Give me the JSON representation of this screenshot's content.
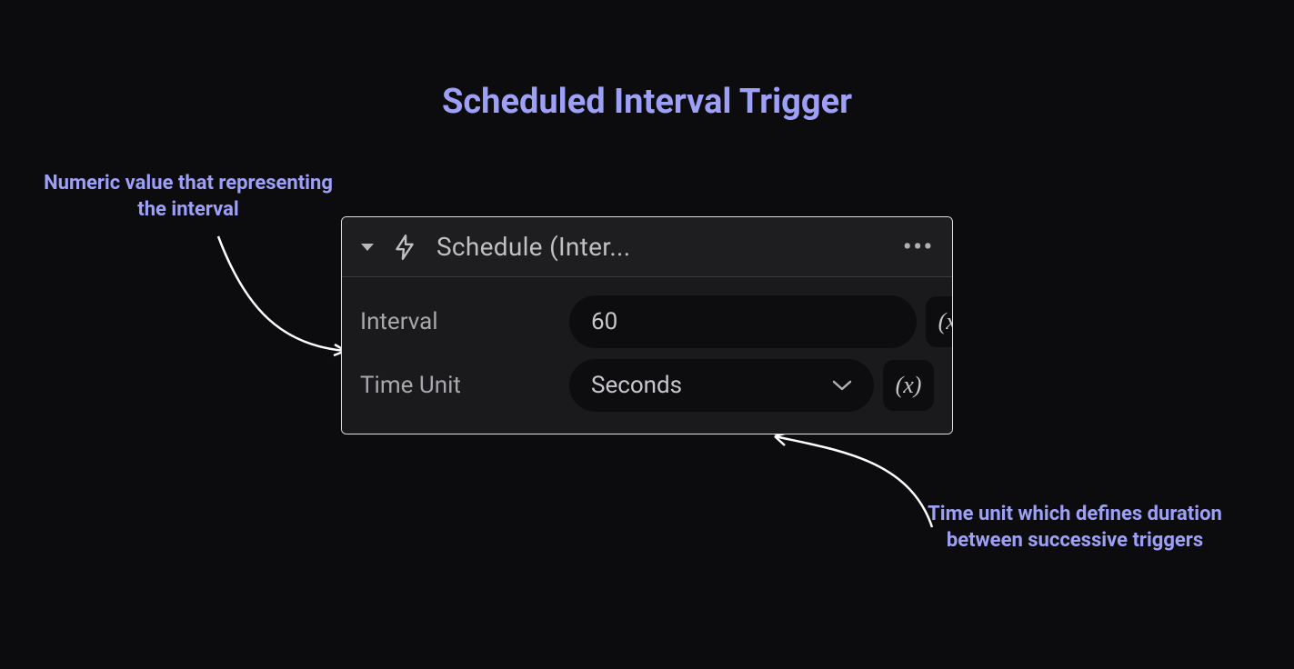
{
  "title": "Scheduled Interval Trigger",
  "annotations": {
    "left": "Numeric value that representing the interval",
    "right": "Time unit which defines duration between successive triggers"
  },
  "panel": {
    "header_title": "Schedule (Inter...",
    "fields": {
      "interval": {
        "label": "Interval",
        "value": "60"
      },
      "time_unit": {
        "label": "Time Unit",
        "value": "Seconds"
      }
    },
    "var_token": "(x)"
  },
  "colors": {
    "accent": "#9ea0f7",
    "background": "#0c0c0f"
  }
}
